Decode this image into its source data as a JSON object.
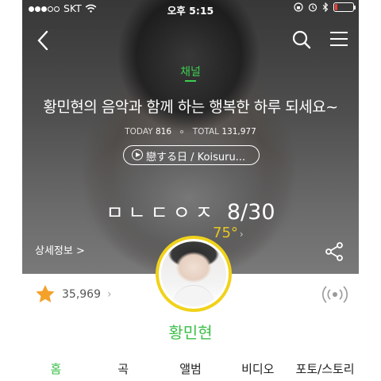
{
  "status_bar": {
    "carrier": "SKT",
    "time": "오후 5:15",
    "signal_dots_filled": 3,
    "signal_dots_total": 5,
    "battery_level": 0.15,
    "battery_color": "#ff3b30",
    "icons": [
      "wifi-icon",
      "orientation-lock-icon",
      "alarm-icon",
      "bluetooth-icon",
      "battery-icon"
    ]
  },
  "nav": {
    "icons": [
      "back-chevron-icon",
      "search-icon",
      "hamburger-menu-icon"
    ]
  },
  "channel": {
    "label": "채널",
    "headline": "황민현의 음악과 함께 하는 행복한 하루 되세요~",
    "today_label": "TODAY",
    "today_count": "816",
    "total_label": "TOTAL",
    "total_count": "131,977",
    "now_playing": "戀する日 / Koisuru...",
    "weather_text": "ㅁㄴㄷㅇㅈ",
    "date": "8/30",
    "temperature": "75°",
    "detail_link": "상세정보 >"
  },
  "profile": {
    "likes": "35,969",
    "name": "황민현"
  },
  "tabs": [
    {
      "label": "홈",
      "active": true
    },
    {
      "label": "곡",
      "active": false
    },
    {
      "label": "앨범",
      "active": false
    },
    {
      "label": "비디오",
      "active": false
    },
    {
      "label": "포토/스토리",
      "active": false
    }
  ],
  "colors": {
    "accent": "#3cbf4a",
    "channel_label": "#3ccf4e",
    "temperature": "#e8c820",
    "avatar_ring": "#f0d21a",
    "star": "#f4a12a"
  }
}
